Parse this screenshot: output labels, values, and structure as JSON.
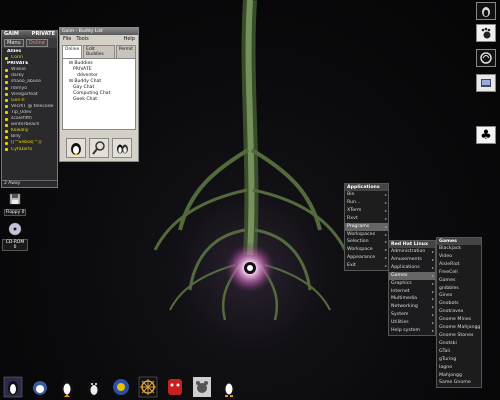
{
  "buddy_window": {
    "title": "GAIM",
    "title_right": "PRIVATE",
    "menu": [
      "Menu",
      "Online"
    ],
    "items": [
      {
        "label": "Allies",
        "kind": "group"
      },
      {
        "label": "Corin",
        "kind": "away"
      },
      {
        "label": "PRIVATE",
        "kind": "group"
      },
      {
        "label": "Wiskie",
        "kind": "normal"
      },
      {
        "label": "darky",
        "kind": "normal"
      },
      {
        "label": "shaoo_abuse",
        "kind": "normal"
      },
      {
        "label": "rdimyo",
        "kind": "normal"
      },
      {
        "label": "Vinegarfeat",
        "kind": "normal"
      },
      {
        "label": "Gon-II",
        "kind": "away"
      },
      {
        "label": "VecifiT @ telecode",
        "kind": "normal"
      },
      {
        "label": "Tip_0dev",
        "kind": "normal"
      },
      {
        "label": "scalefifth",
        "kind": "normal"
      },
      {
        "label": "winterbeach",
        "kind": "normal"
      },
      {
        "label": "Kowally",
        "kind": "away"
      },
      {
        "label": "Billy",
        "kind": "normal"
      },
      {
        "label": "[[^Sebos[^]]",
        "kind": "away"
      },
      {
        "label": "CyhDarts",
        "kind": "away"
      }
    ],
    "status": "2 Away"
  },
  "gaim_window": {
    "title": "Gaim - Buddy List",
    "menu": [
      "File",
      "Tools"
    ],
    "help": "Help",
    "tabs": [
      "Online",
      "Edit Buddies",
      "Permit"
    ],
    "tree": [
      {
        "label": "Buddies",
        "level": 1
      },
      {
        "label": "PRIVATE",
        "level": 2
      },
      {
        "label": "ddventor",
        "level": 3
      },
      {
        "label": "Buddy Chat",
        "level": 1
      },
      {
        "label": "Gay Chat",
        "level": 2
      },
      {
        "label": "Computing Chat",
        "level": 2
      },
      {
        "label": "Geek Chat",
        "level": 2
      }
    ],
    "buttons": [
      "im-button",
      "info-button",
      "chat-button"
    ]
  },
  "desktop_icons": [
    {
      "label": "Floppy 0",
      "icon": "floppy-icon"
    },
    {
      "label": "CD-ROM 0",
      "icon": "cdrom-icon"
    }
  ],
  "dock": [
    "penguin-dock-icon",
    "gnome-dock-icon",
    "gaim-dock-icon",
    "apps-dock-icon",
    "clubs-dock-icon"
  ],
  "menus": {
    "main": {
      "header": "Applications",
      "items": [
        "Bin",
        "Run...",
        "XTerm",
        "Rxvt",
        "Programs",
        "Workspaces",
        "Selection",
        "Workspace",
        "Appearance",
        "Exit"
      ],
      "selected": 4
    },
    "redhat": {
      "header": "Red Hat Linux",
      "items": [
        "Administration",
        "Amusements",
        "Applications",
        "Games",
        "Graphics",
        "Internet",
        "Multimedia",
        "Networking",
        "System",
        "Utilities",
        "Help system"
      ],
      "selected": 3
    },
    "games": {
      "header": "Games",
      "items": [
        "Blackjack",
        "Video",
        "AisleRiot",
        "FreeCell",
        "Games",
        "gnibbles",
        "Gines",
        "Gnobots",
        "Gnotravex",
        "Gnome Mines",
        "Gnome Mahjongg",
        "Gnome Stones",
        "Gnotski",
        "GTali",
        "gTuring",
        "Iagno",
        "Mahjongg",
        "Same Gnome"
      ],
      "selected": -1
    }
  },
  "taskbar": [
    "penguin-task-icon",
    "gnome-foot-task-icon",
    "penguin-task-icon",
    "tux-task-icon",
    "arcade-task-icon",
    "ship-wheel-task-icon",
    "monster-task-icon",
    "teddy-task-icon",
    "tux-task-icon"
  ]
}
